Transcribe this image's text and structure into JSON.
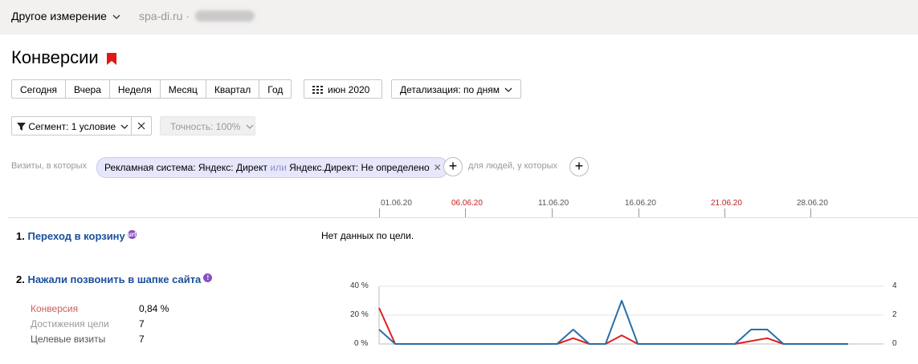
{
  "topbar": {
    "dimension_label": "Другое измерение",
    "site": "spa-di.ru"
  },
  "page_title": "Конверсии",
  "periods": [
    "Сегодня",
    "Вчера",
    "Неделя",
    "Месяц",
    "Квартал",
    "Год"
  ],
  "date_button": "июн 2020",
  "detail_button": "Детализация: по дням",
  "segment_button": "Сегмент: 1 условие",
  "accuracy_button": "Точность: 100%",
  "filter": {
    "prefix": "Визиты, в которых",
    "chip_part1": "Рекламная система: Яндекс: Директ",
    "chip_or": "или",
    "chip_part2": "Яндекс.Директ: Не определено",
    "people_label": "для людей, у которых"
  },
  "timeline_dates": [
    {
      "label": "01.06.20",
      "weekend": false
    },
    {
      "label": "06.06.20",
      "weekend": true
    },
    {
      "label": "11.06.20",
      "weekend": false
    },
    {
      "label": "16.06.20",
      "weekend": false
    },
    {
      "label": "21.06.20",
      "weekend": true
    },
    {
      "label": "28.06.20",
      "weekend": false
    }
  ],
  "goals": [
    {
      "num": "1.",
      "name": "Переход в корзину",
      "no_data": "Нет данных по цели."
    },
    {
      "num": "2.",
      "name": "Нажали позвонить в шапке сайта",
      "metrics": [
        {
          "label": "Конверсия",
          "value": "0,84 %",
          "color": "#d05a5a"
        },
        {
          "label": "Достижения цели",
          "value": "7",
          "color": "#999999"
        },
        {
          "label": "Целевые визиты",
          "value": "7",
          "color": "#555555"
        }
      ]
    }
  ],
  "chart_data": {
    "type": "line",
    "title": "",
    "x": [
      "01.06",
      "02.06",
      "03.06",
      "04.06",
      "05.06",
      "06.06",
      "07.06",
      "08.06",
      "09.06",
      "10.06",
      "11.06",
      "12.06",
      "13.06",
      "14.06",
      "15.06",
      "16.06",
      "17.06",
      "18.06",
      "19.06",
      "20.06",
      "21.06",
      "22.06",
      "23.06",
      "24.06",
      "25.06",
      "26.06",
      "27.06",
      "28.06",
      "29.06",
      "30.06"
    ],
    "series": [
      {
        "axis": "left",
        "unit": "%",
        "color": "#e02020",
        "values": [
          25,
          0,
          0,
          0,
          0,
          0,
          0,
          0,
          0,
          0,
          0,
          0,
          4,
          0,
          0,
          6,
          0,
          0,
          0,
          0,
          0,
          0,
          0,
          2,
          4,
          0,
          0,
          0,
          0,
          0
        ]
      },
      {
        "axis": "right",
        "color": "#2a6fa8",
        "values": [
          1,
          0,
          0,
          0,
          0,
          0,
          0,
          0,
          0,
          0,
          0,
          0,
          1,
          0,
          0,
          3,
          0,
          0,
          0,
          0,
          0,
          0,
          0,
          1,
          1,
          0,
          0,
          0,
          0,
          0
        ]
      }
    ],
    "yleft_ticks": [
      "40 %",
      "20 %",
      "0 %"
    ],
    "yright_ticks": [
      "4",
      "2",
      "0"
    ],
    "yleft_range": [
      0,
      40
    ],
    "yright_range": [
      0,
      4
    ]
  }
}
